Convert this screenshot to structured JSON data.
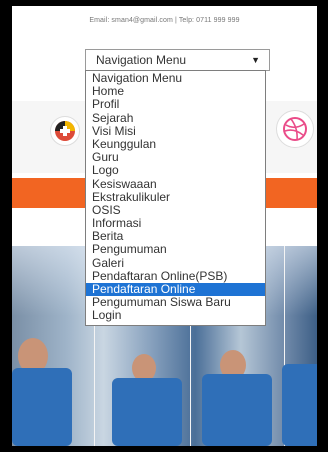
{
  "contact_line": "Email: sman4@gmail.com | Telp: 0711 999 999",
  "nav": {
    "selected": "Navigation Menu",
    "options": [
      "Navigation Menu",
      "Home",
      "Profil",
      "Sejarah",
      "Visi Misi",
      "Keunggulan",
      "Guru",
      "Logo",
      "Kesiswaaan",
      "Ekstrakulikuler",
      "OSIS",
      "Informasi",
      "Berita",
      "Pengumuman",
      "Galeri",
      "Pendaftaran Online(PSB)",
      "Pendaftaran Online",
      "Pengumuman Siswa Baru",
      "Login"
    ],
    "highlighted_index": 16
  },
  "icons": {
    "left": "google-plus-icon",
    "right": "dribbble-icon"
  },
  "colors": {
    "accent_orange": "#f26522",
    "highlight_blue": "#1e73d4",
    "dribbble_pink": "#ea4c89"
  }
}
